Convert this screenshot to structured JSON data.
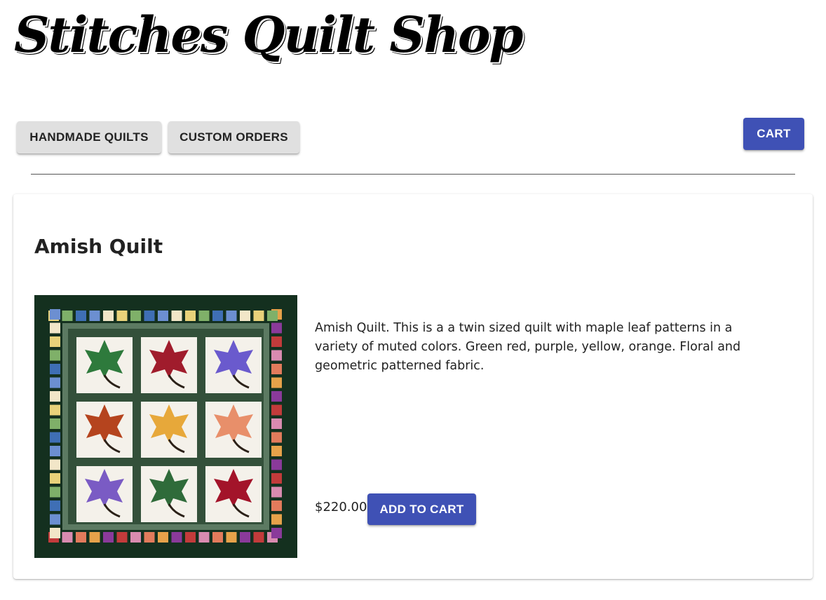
{
  "site": {
    "title": "Stitches Quilt Shop"
  },
  "nav": {
    "items": [
      {
        "label": "HANDMADE QUILTS"
      },
      {
        "label": "CUSTOM ORDERS"
      }
    ],
    "cart_label": "CART"
  },
  "product": {
    "title": "Amish Quilt",
    "description": "Amish Quilt. This is a a twin sized quilt with maple leaf patterns in a variety of muted colors. Green red, purple, yellow, orange. Floral and geometric patterned fabric.",
    "price": "$220.00",
    "add_to_cart_label": "ADD TO CART",
    "image_icon": "quilt-photo"
  },
  "colors": {
    "primary": "#3f51b5",
    "secondary_button": "#e0e0e0",
    "quilt_background": "#14301f"
  }
}
